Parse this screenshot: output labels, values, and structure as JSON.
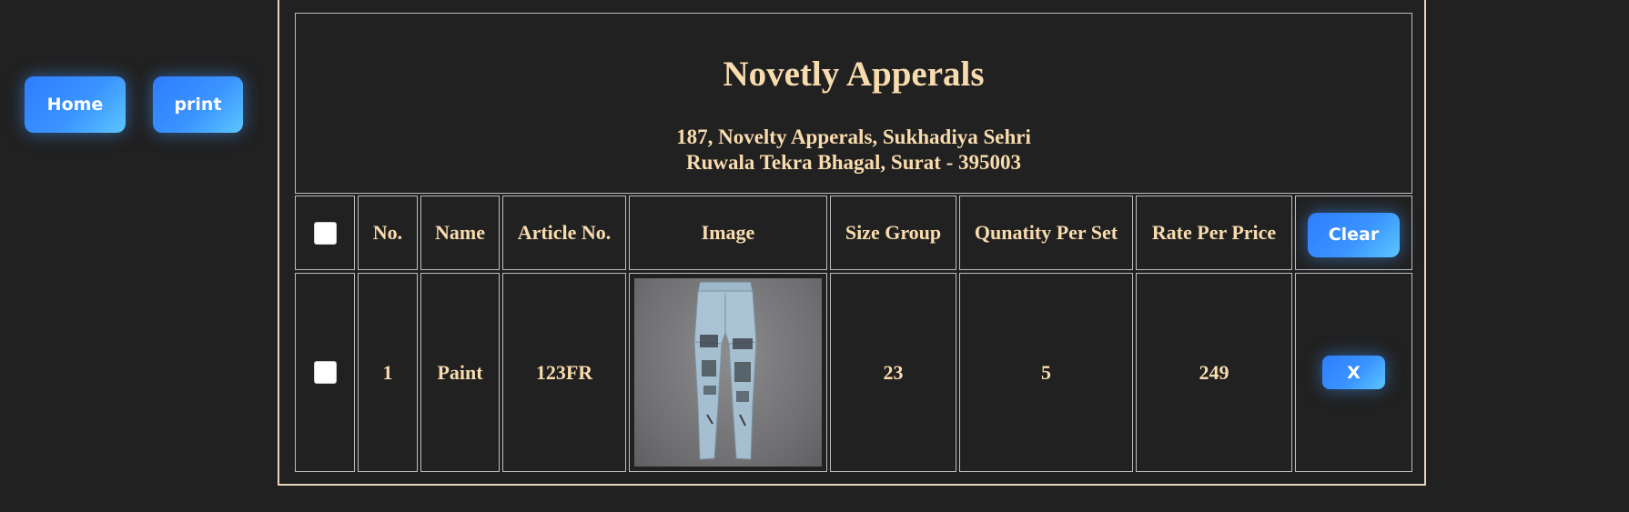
{
  "nav": {
    "home_label": "Home",
    "print_label": "print"
  },
  "header": {
    "company_name": "Novetly Apperals",
    "address_line1": "187, Novelty Apperals, Sukhadiya Sehri",
    "address_line2": "Ruwala Tekra Bhagal, Surat - 395003"
  },
  "table": {
    "columns": [
      "No.",
      "Name",
      "Article No.",
      "Image",
      "Size Group",
      "Qunatity Per Set",
      "Rate Per Price"
    ],
    "clear_label": "Clear",
    "rows": [
      {
        "no": "1",
        "name": "Paint",
        "article_no": "123FR",
        "image_icon": "jeans-image",
        "size_group": "23",
        "quantity_per_set": "5",
        "rate_per_price": "249",
        "remove_label": "X"
      }
    ]
  },
  "colors": {
    "background": "#212121",
    "text": "#f9dcae",
    "button": "#3a94ff"
  }
}
